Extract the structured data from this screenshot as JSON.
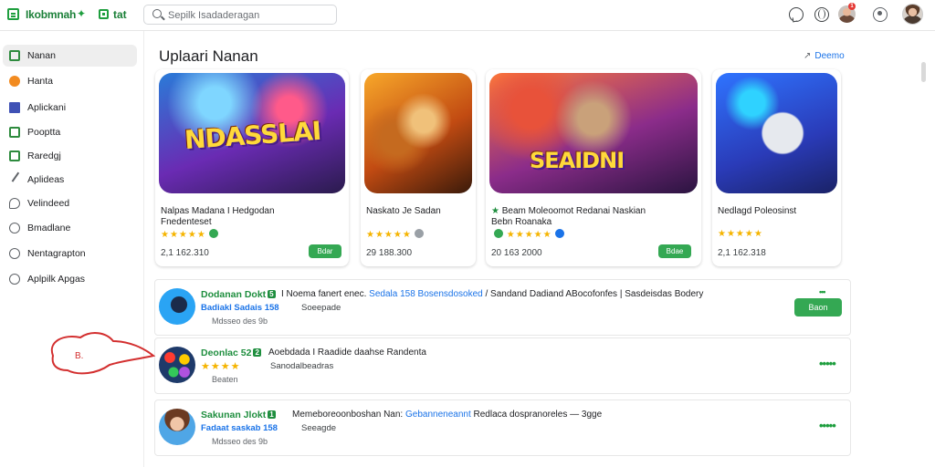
{
  "header": {
    "brand": "Ikobmnah",
    "tv_label": "tat",
    "search_placeholder": "Sepilk Isadaderagan"
  },
  "notifications": {
    "badge": "1"
  },
  "sidebar": {
    "items": [
      {
        "label": "Nanan",
        "icon": "home-icon",
        "active": true
      },
      {
        "label": "Hanta",
        "icon": "game-icon"
      },
      {
        "label": "Aplickani",
        "icon": "apps-icon"
      },
      {
        "label": "Pooptta",
        "icon": "movie-icon"
      },
      {
        "label": "Raredgj",
        "icon": "book-icon"
      },
      {
        "label": "Aplideas",
        "icon": "pen-icon"
      },
      {
        "label": "Velindeed",
        "icon": "chat-icon"
      },
      {
        "label": "Bmadlane",
        "icon": "clock-icon"
      },
      {
        "label": "Nentagrapton",
        "icon": "smile-icon"
      },
      {
        "label": "Aplpilk Apgas",
        "icon": "info-icon"
      }
    ]
  },
  "section": {
    "title": "Uplaari Nanan",
    "see_more": "Deemo"
  },
  "cards": [
    {
      "art_text": "NDASSLAI",
      "title": "Nalpas Madana I Hedgodan",
      "subtitle": "Fnedenteset",
      "stars": "★★★★★",
      "count": "2,1 162.310",
      "button": "Bdar"
    },
    {
      "art_text": "",
      "title": "Naskato Je Sadan",
      "subtitle": "",
      "stars": "★★★★★",
      "count": "29 188.300",
      "button": ""
    },
    {
      "art_text": "SEAIDNI",
      "title": "Beam Moleoomot Redanai Naskian",
      "subtitle": "Bebn Roanaka",
      "stars": "",
      "count": "20 163 2000",
      "button": "Bdae"
    },
    {
      "art_text": "",
      "title": "Nedlagd Poleosinst",
      "subtitle": "",
      "stars": "★★★★★",
      "count": "2,1 162.318",
      "button": ""
    }
  ],
  "rows": [
    {
      "title": "Dodanan Dokt",
      "badge": "5",
      "desc_plain": "I Noema fanert enec.",
      "desc_link": "Sedala 158 Bosensdosoked",
      "desc_tail": "/ Sandand Dadiand ABocofonfes | Sasdeisdas Bodery",
      "sub": "Badiakl Sadais 158",
      "sub_right": "Soeepade",
      "sub2": "Mdsseo des 9b",
      "button": "Baon",
      "dots": ""
    },
    {
      "title": "Deonlac 52",
      "badge": "2",
      "desc_plain": "Aoebdada I Raadide daahse Randenta",
      "desc_link": "",
      "desc_tail": "",
      "sub": "",
      "sub_right": "Sanodalbeadras",
      "sub2": "Beaten",
      "stars": "★★★★",
      "button": "",
      "dots": "•••••"
    },
    {
      "title": "Sakunan Jlokt",
      "badge": "1",
      "desc_plain": "Memeboreoonboshan Nan:",
      "desc_link": "Gebanneneannt",
      "desc_tail": "Redlaca dospranoreles — 3gge",
      "sub": "Fadaat saskab 158",
      "sub_right": "Seeagde",
      "sub2": "Mdsseo des 9b",
      "button": "",
      "dots": "•••••"
    }
  ],
  "annotation": {
    "label": "B.",
    "color": "#d32f2f"
  }
}
